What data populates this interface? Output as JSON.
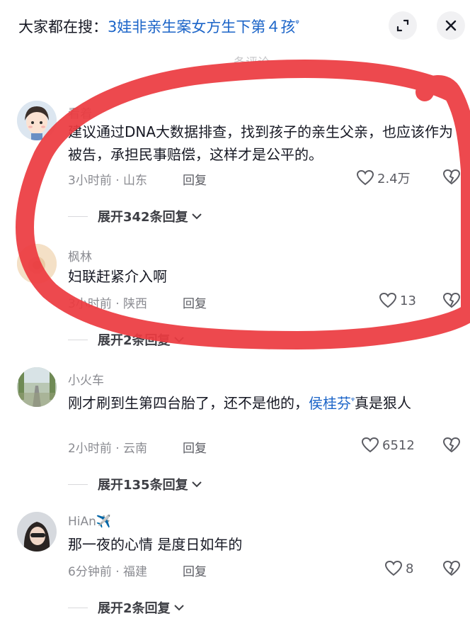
{
  "search_bar": {
    "prefix": "大家都在搜：",
    "query": "3娃非亲生案女方生下第４孩",
    "magnifier": "ᵠ"
  },
  "faint_header": "条评论",
  "comments": [
    {
      "name": "看着",
      "text": "建议通过DNA大数据排查，找到孩子的亲生父亲，也应该作为被告，承担民事赔偿，这样才是公平的。",
      "meta": "3小时前 · 山东",
      "reply": "回复",
      "likes": "2.4万",
      "expand": "展开342条回复"
    },
    {
      "name": "枫林",
      "text": "妇联赶紧介入啊",
      "meta": "3小时前 · 陕西",
      "reply": "回复",
      "likes": "13",
      "expand": "展开2条回复"
    },
    {
      "name": "小火车",
      "text_before": "刚才刷到生第四台胎了，还不是他的，",
      "mention": "侯桂芬",
      "mention_mag": "ᵠ",
      "text_after": "真是狠人",
      "meta": "2小时前 · 云南",
      "reply": "回复",
      "likes": "6512",
      "expand": "展开135条回复"
    },
    {
      "name": "HiAn✈️",
      "text": "那一夜的心情 是度日如年的",
      "meta": "6分钟前 · 福建",
      "reply": "回复",
      "likes": "8",
      "expand": "展开2条回复"
    }
  ],
  "colors": {
    "link": "#1b64c8",
    "scribble": "#ec3b41",
    "muted": "#8a8b91"
  },
  "icons": [
    "expand-icon",
    "close-icon",
    "heart-icon",
    "broken-heart-icon",
    "chevron-down-icon"
  ]
}
